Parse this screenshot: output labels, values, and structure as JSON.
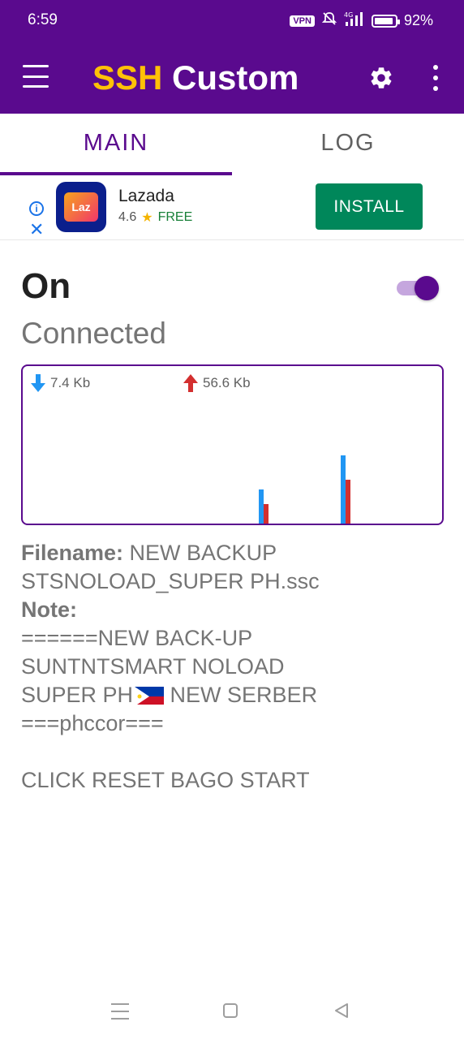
{
  "status_bar": {
    "time": "6:59",
    "vpn": "VPN",
    "network": "4G",
    "battery": "92%",
    "battery_level": 0.92
  },
  "app_bar": {
    "title_part1": "SSH",
    "title_part2": " Custom",
    "accent_color": "#ffc107",
    "bar_color": "#5a0a8e",
    "icons": [
      "menu-icon",
      "gear-icon",
      "more-vert-icon"
    ]
  },
  "tabs": [
    {
      "label": "MAIN",
      "active": true
    },
    {
      "label": "LOG",
      "active": false
    }
  ],
  "ad": {
    "app_name": "Lazada",
    "logo_text": "Laz",
    "rating": "4.6",
    "price": "FREE",
    "install_label": "INSTALL",
    "install_color": "#00875a"
  },
  "connection": {
    "state": "On",
    "status": "Connected",
    "toggle_on": true
  },
  "graph": {
    "download_label": "7.4 Kb",
    "upload_label": "56.6 Kb",
    "download_color": "#2196f3",
    "upload_color": "#d32f2f"
  },
  "info": {
    "filename_label": "Filename:",
    "filename_value": " NEW BACKUP STSNOLOAD_SUPER PH.ssc",
    "note_label": "Note:",
    "note_line1": "======NEW BACK-UP",
    "note_line2": "SUNTNTSMART NOLOAD",
    "note_line3a": "SUPER PH",
    "note_line3b": " NEW SERBER",
    "note_line4": "===phccor===",
    "note_line5": "CLICK RESET BAGO START"
  },
  "nav_bar": {
    "icons": [
      "recent-apps-icon",
      "home-icon",
      "back-icon"
    ]
  }
}
